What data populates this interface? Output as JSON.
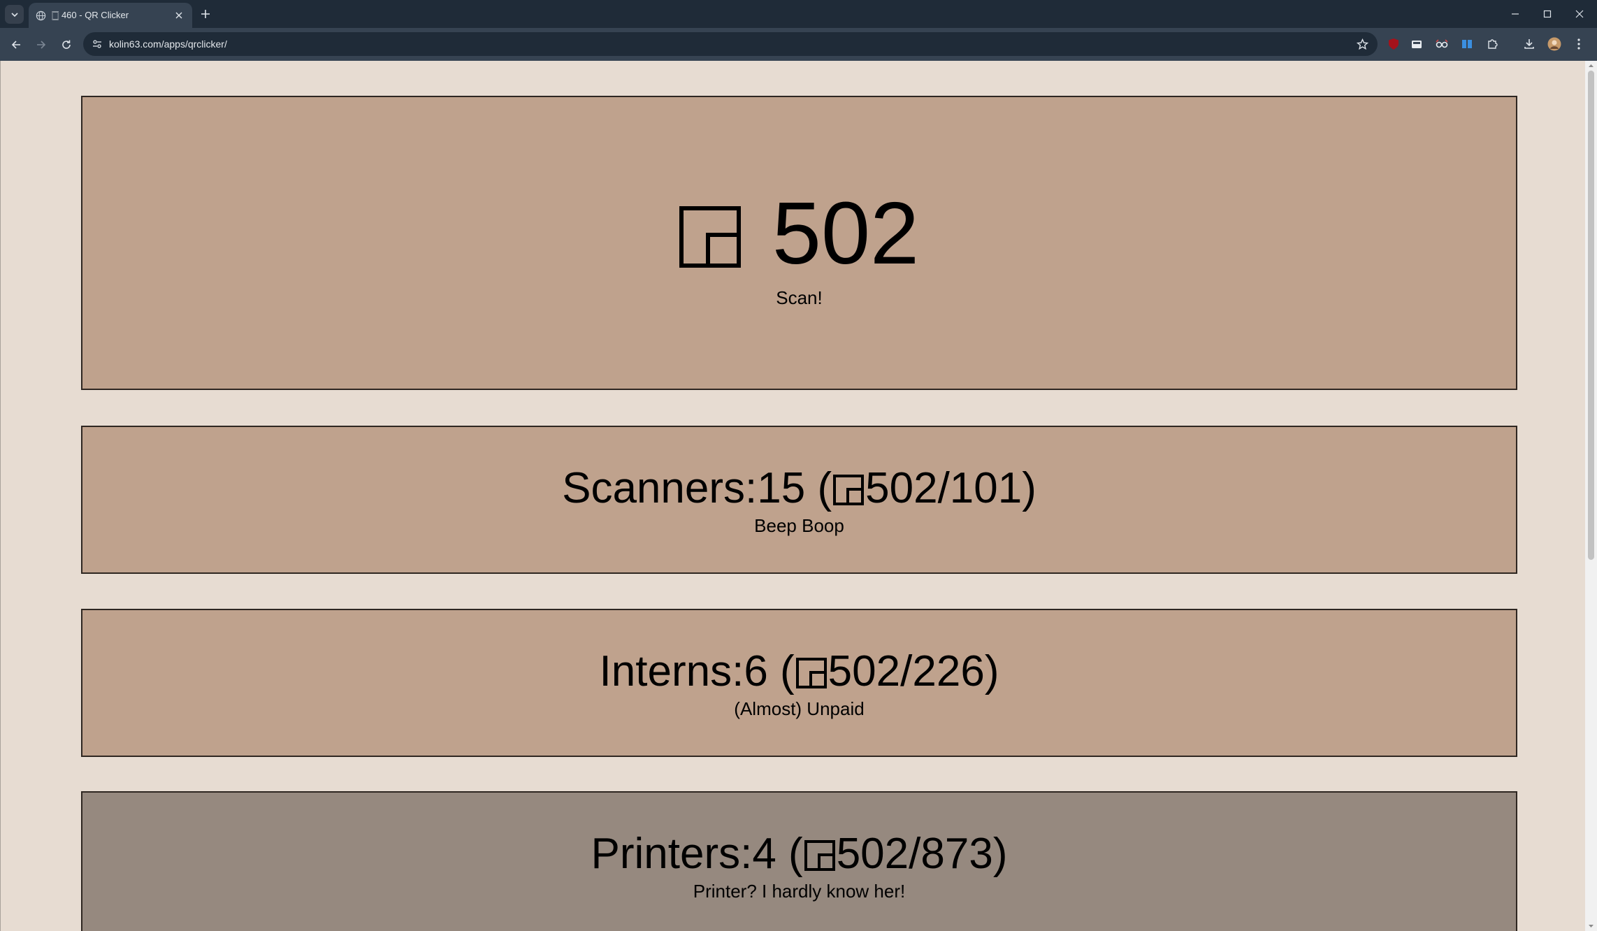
{
  "browser": {
    "tab_title": "🀆 460 - QR Clicker",
    "url": "kolin63.com/apps/qrclicker/",
    "accent": "#1f2b38"
  },
  "game": {
    "count": "502",
    "scan_label": "Scan!",
    "upgrades": [
      {
        "name": "Scanners",
        "owned": "15",
        "current": "502",
        "cost": "101",
        "tagline": "Beep Boop",
        "affordable": true
      },
      {
        "name": "Interns",
        "owned": "6",
        "current": "502",
        "cost": "226",
        "tagline": "(Almost) Unpaid",
        "affordable": true
      },
      {
        "name": "Printers",
        "owned": "4",
        "current": "502",
        "cost": "873",
        "tagline": "Printer? I hardly know her!",
        "affordable": false
      }
    ],
    "colors": {
      "background": "#e7dcd2",
      "card": "#bfa28d",
      "card_disabled": "#96897f"
    }
  }
}
